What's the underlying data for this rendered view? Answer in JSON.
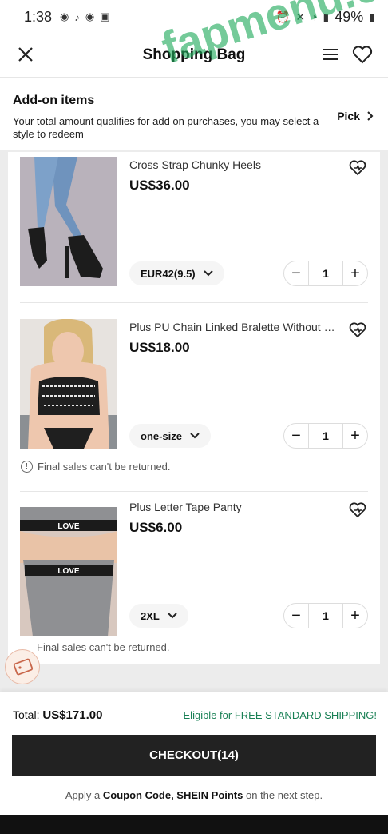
{
  "status_bar": {
    "time": "1:38",
    "battery": "49%"
  },
  "header": {
    "title": "Shopping Bag"
  },
  "addon": {
    "title": "Add-on items",
    "description": "Your total amount qualifies for add on purchases, you may select a style to redeem",
    "pick_label": "Pick"
  },
  "items": [
    {
      "name": "Cross Strap Chunky Heels",
      "price": "US$36.00",
      "size": "EUR42(9.5)",
      "qty": "1"
    },
    {
      "name": "Plus PU Chain Linked Bralette Without Lin...",
      "price": "US$18.00",
      "size": "one-size",
      "qty": "1",
      "note": "Final sales can't be returned."
    },
    {
      "name": "Plus Letter Tape Panty",
      "price": "US$6.00",
      "size": "2XL",
      "qty": "1",
      "note": "Final sales can't be returned.",
      "tape_text": "LOVE"
    }
  ],
  "footer": {
    "total_label": "Total:",
    "total_value": "US$171.00",
    "shipping": "Eligible for FREE STANDARD SHIPPING!",
    "checkout_label": "CHECKOUT(14)",
    "hint_pre": "Apply a",
    "hint_bold": "Coupon Code, SHEIN Points",
    "hint_post": "on the next step."
  },
  "watermark": "fapmenu.com",
  "colors": {
    "accent_green": "#198055",
    "checkout_bg": "#222222",
    "watermark": "#1eaa5a"
  }
}
